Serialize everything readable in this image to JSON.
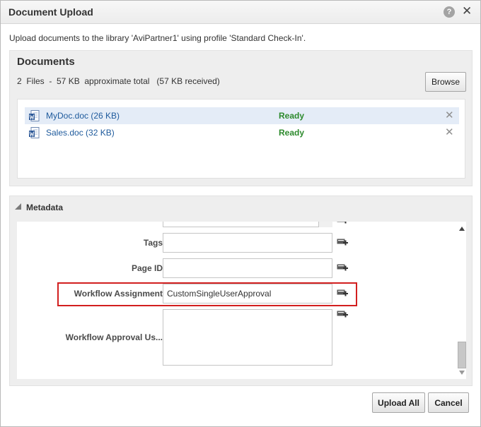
{
  "dialog": {
    "title": "Document Upload",
    "help_glyph": "?",
    "close_glyph": "✕",
    "intro": "Upload documents to the library 'AviPartner1' using profile 'Standard Check-In'."
  },
  "documents": {
    "heading": "Documents",
    "summary": "2  Files  -  57 KB  approximate total   (57 KB received)",
    "browse_label": "Browse",
    "files": [
      {
        "name": "MyDoc.doc (26 KB)",
        "status": "Ready",
        "selected": true
      },
      {
        "name": "Sales.doc (32 KB)",
        "status": "Ready",
        "selected": false
      }
    ],
    "remove_glyph": "✕",
    "file_icon": "word-document-icon"
  },
  "metadata": {
    "heading": "Metadata",
    "fields": {
      "tags": {
        "label": "Tags:",
        "value": ""
      },
      "page_id": {
        "label": "Page ID:",
        "value": ""
      },
      "workflow_assignment": {
        "label": "Workflow Assignment:",
        "value": "CustomSingleUserApproval"
      },
      "workflow_approval_users": {
        "label": "Workflow Approval Us...:",
        "value": ""
      }
    },
    "add_icon": "add-metadata-icon"
  },
  "footer": {
    "upload_all_label": "Upload All",
    "cancel_label": "Cancel"
  },
  "colors": {
    "status_ready": "#2d8a2d",
    "link": "#1e5a9c",
    "highlight": "#d21f1f",
    "selected_row": "#e4ecf7"
  }
}
